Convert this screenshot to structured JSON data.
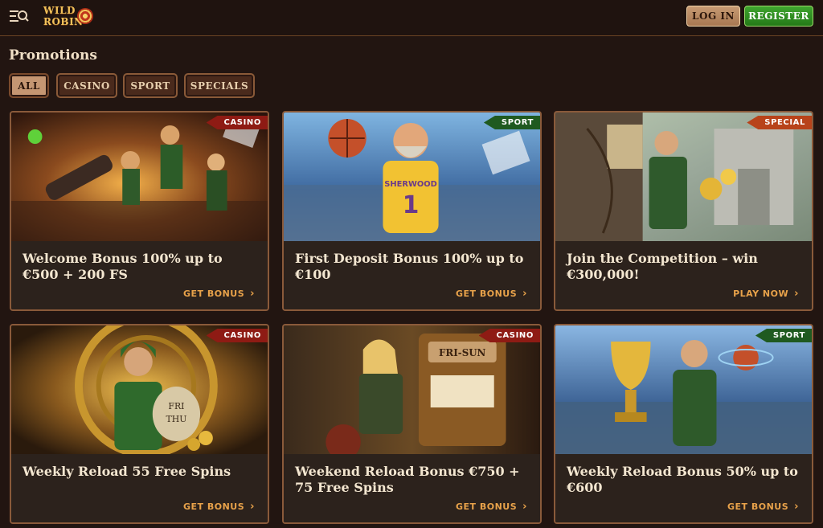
{
  "header": {
    "logo_line1": "WILD",
    "logo_line2": "ROBIN",
    "login_label": "LOG IN",
    "register_label": "REGISTER"
  },
  "page": {
    "title": "Promotions"
  },
  "filters": [
    {
      "label": "ALL",
      "active": true
    },
    {
      "label": "CASINO",
      "active": false
    },
    {
      "label": "SPORT",
      "active": false
    },
    {
      "label": "SPECIALS",
      "active": false
    }
  ],
  "cards": [
    {
      "badge": "CASINO",
      "title": "Welcome Bonus 100% up to €500 + 200 FS",
      "cta": "GET BONUS"
    },
    {
      "badge": "SPORT",
      "title": "First Deposit Bonus 100% up to €100",
      "cta": "GET BONUS"
    },
    {
      "badge": "SPECIAL",
      "title": "Join the Competition – win €300,000!",
      "cta": "PLAY NOW"
    },
    {
      "badge": "CASINO",
      "title": "Weekly Reload 55 Free Spins",
      "cta": "GET BONUS"
    },
    {
      "badge": "CASINO",
      "title": "Weekend Reload Bonus €750 + 75 Free Spins",
      "cta": "GET BONUS"
    },
    {
      "badge": "SPORT",
      "title": "Weekly Reload Bonus 50% up to €600",
      "cta": "GET BONUS"
    }
  ],
  "art_text": {
    "jersey": "SHERWOOD",
    "jersey_number": "1",
    "bag_line1": "FRI",
    "bag_line2": "THU",
    "slot_sign": "FRI-SUN"
  },
  "colors": {
    "background": "#221511",
    "accent_cta": "#e8a24a",
    "register_green": "#2f8f22",
    "badge_casino": "#8e1b14",
    "badge_sport": "#1f5a20",
    "badge_special": "#b8431a"
  }
}
